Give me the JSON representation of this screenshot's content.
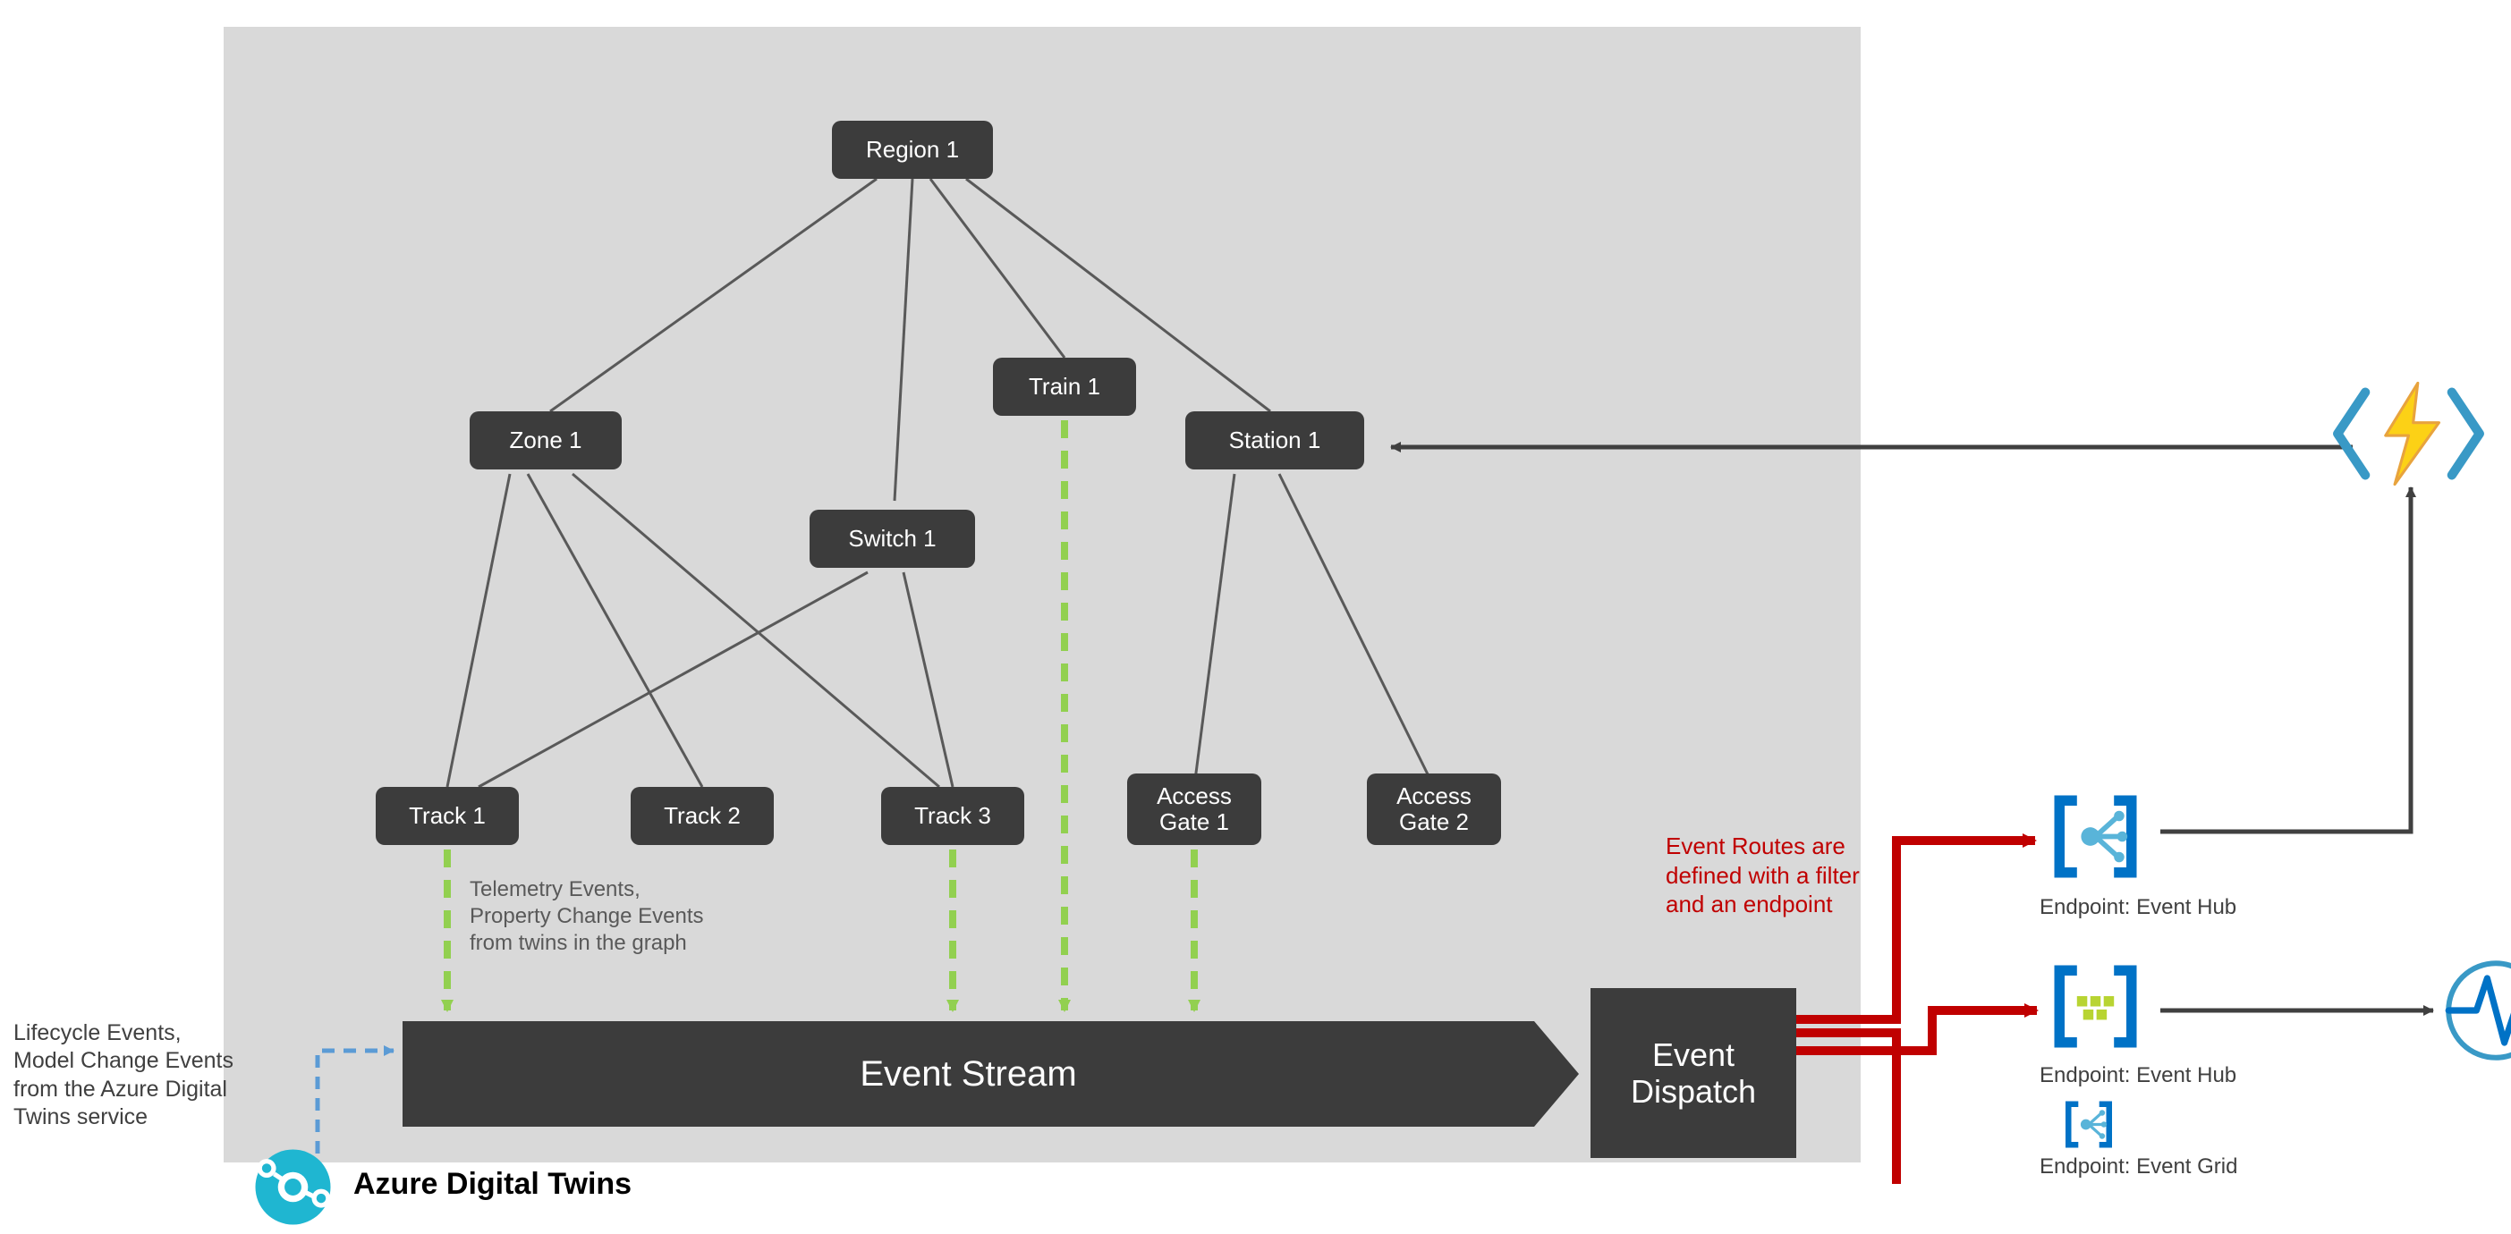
{
  "nodes": {
    "region1": "Region 1",
    "zone1": "Zone 1",
    "train1": "Train 1",
    "station1": "Station 1",
    "switch1": "Switch 1",
    "track1": "Track 1",
    "track2": "Track 2",
    "track3": "Track 3",
    "gate1": "Access\nGate 1",
    "gate2": "Access\nGate 2"
  },
  "bars": {
    "eventstream": "Event Stream",
    "dispatch": "Event\nDispatch"
  },
  "labels": {
    "telemetry": "Telemetry Events,\nProperty Change Events\nfrom twins in the graph",
    "lifecycle": "Lifecycle Events,\nModel Change Events\nfrom the Azure Digital\nTwins service",
    "routes": "Event Routes are\ndefined with a filter\nand an endpoint",
    "adt": "Azure Digital Twins",
    "ep1": "Endpoint: Event Hub",
    "ep2": "Endpoint: Event Hub",
    "ep3": "Endpoint: Event Grid"
  }
}
